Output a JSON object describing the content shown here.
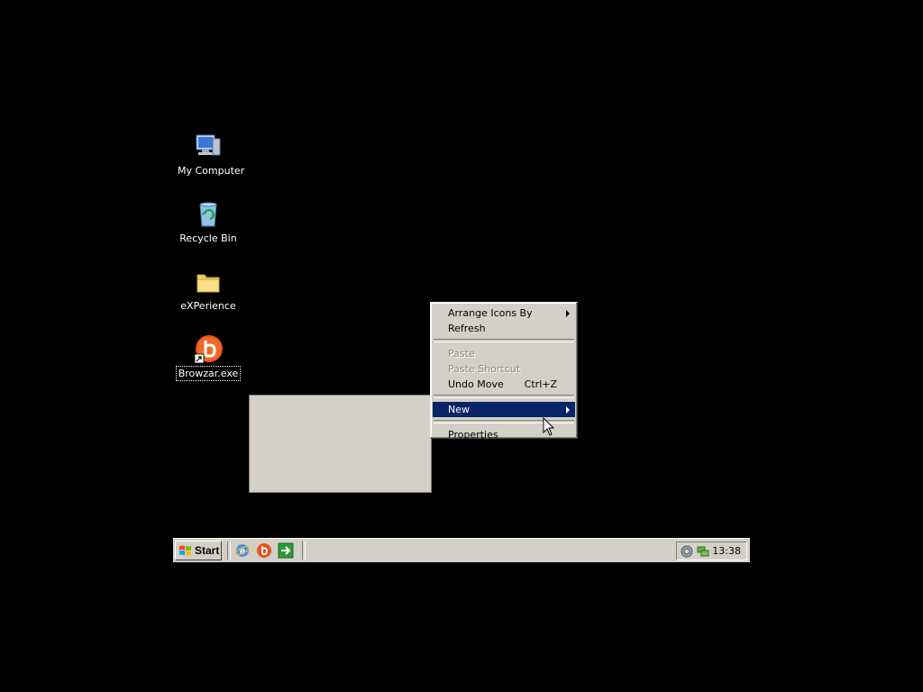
{
  "desktop": {
    "icons": [
      {
        "label": "My Computer",
        "icon": "computer-icon"
      },
      {
        "label": "Recycle Bin",
        "icon": "recycle-bin-icon"
      },
      {
        "label": "eXPerience",
        "icon": "folder-icon"
      },
      {
        "label": "Browzar.exe",
        "icon": "browzar-shortcut-icon",
        "selected": true
      }
    ]
  },
  "context_menu": {
    "items": [
      {
        "label": "Arrange Icons By",
        "submenu": true
      },
      {
        "label": "Refresh"
      },
      {
        "label": "Paste",
        "disabled": true
      },
      {
        "label": "Paste Shortcut",
        "disabled": true
      },
      {
        "label": "Undo Move",
        "shortcut": "Ctrl+Z"
      },
      {
        "label": "New",
        "submenu": true,
        "highlighted": true
      },
      {
        "label": "Properties"
      }
    ]
  },
  "taskbar": {
    "start_label": "Start",
    "quick_launch": [
      "ie-icon",
      "browzar-icon",
      "show-desktop-arrow-icon"
    ],
    "tray": {
      "icons": [
        "volume-icon",
        "network-icon"
      ],
      "clock": "13:38"
    }
  },
  "colors": {
    "desktop_bg": "#000000",
    "menu_bg": "#d4d0c8",
    "highlight": "#0a246a"
  }
}
